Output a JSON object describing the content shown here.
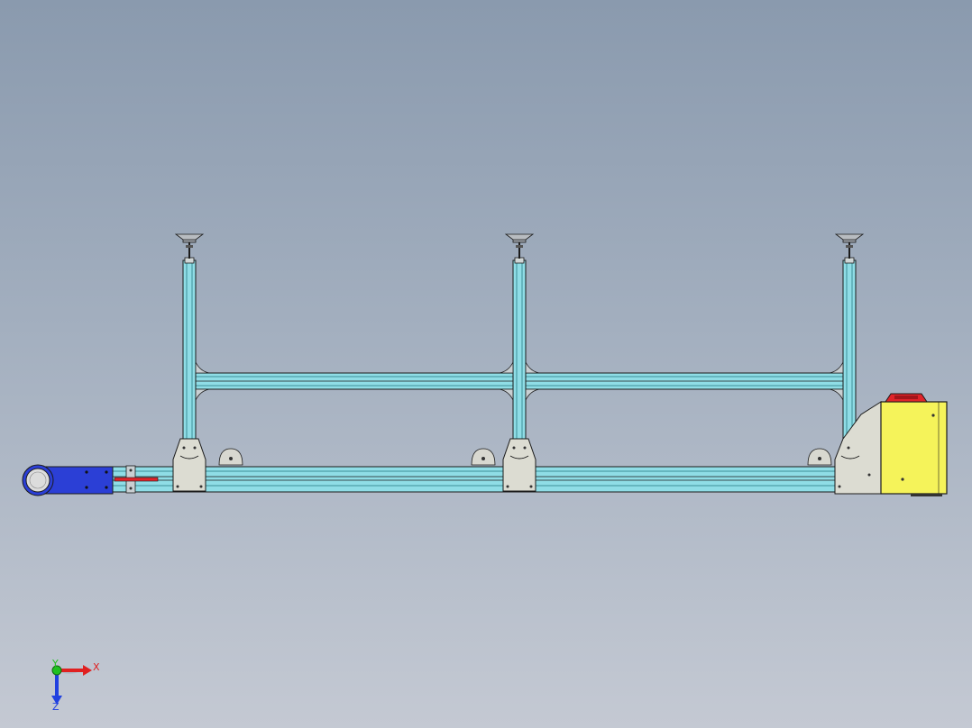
{
  "colors": {
    "profile": "#8fdde6",
    "profile_dark": "#3c8f98",
    "outline": "#1b1b1b",
    "bracket": "#dcdcd2",
    "motor": "#2b3fd6",
    "electrical_box": "#f5f35a",
    "handle": "#e0242a",
    "axis_x": "#e02020",
    "axis_y": "#20c020",
    "axis_z": "#2040e0"
  },
  "triad": {
    "x_label": "X",
    "y_label": "Y",
    "z_label": "Z",
    "x_icon": "x-axis-arrow-icon",
    "y_icon": "y-axis-dot-icon",
    "z_icon": "z-axis-arrow-icon"
  }
}
